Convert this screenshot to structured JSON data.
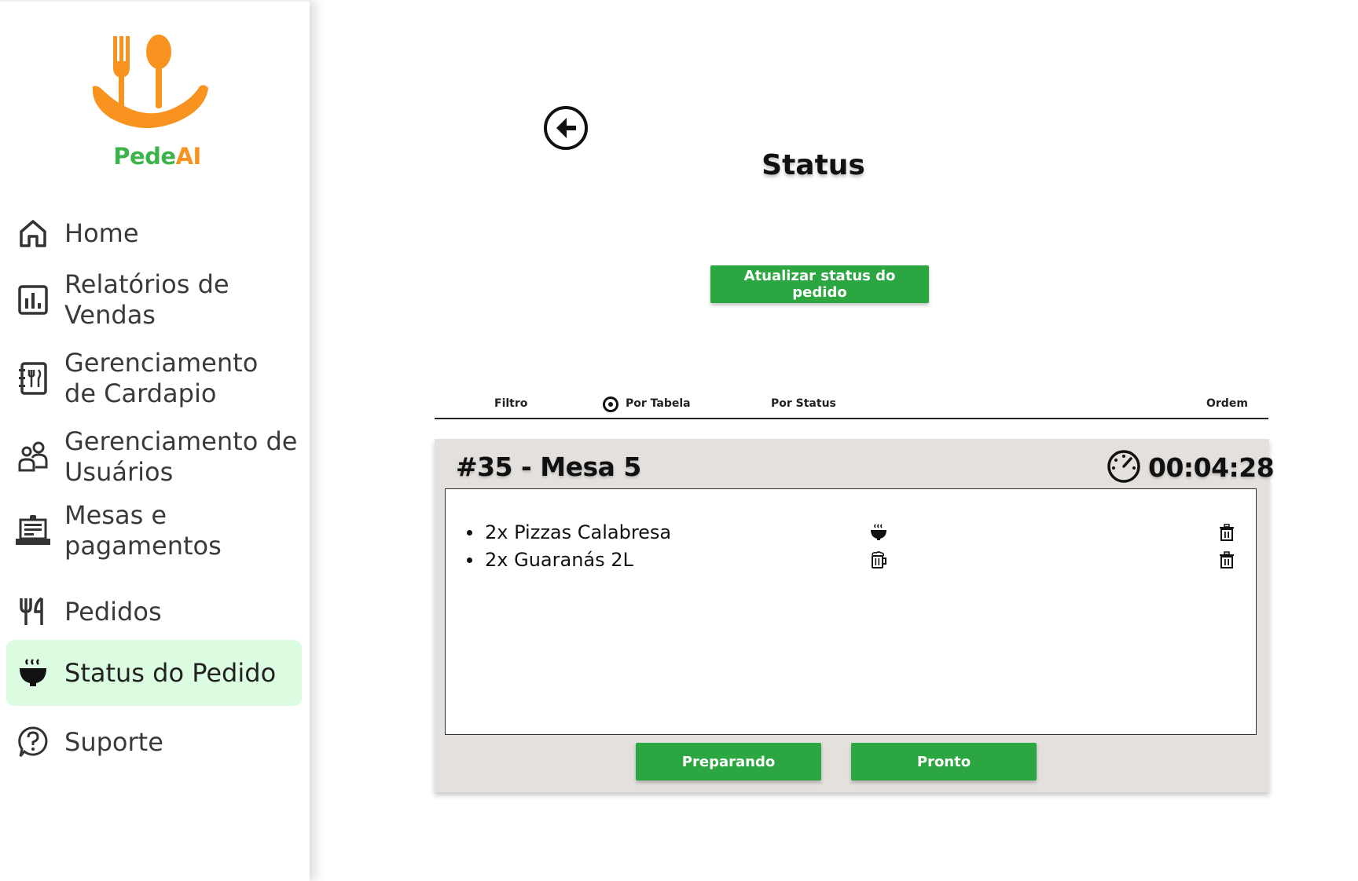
{
  "brand": {
    "name_part1": "Pede",
    "name_part2": "AI",
    "color_green": "#3cb44b",
    "color_orange": "#f7931e"
  },
  "sidebar": {
    "items": [
      {
        "label": "Home",
        "icon": "home-icon"
      },
      {
        "label": "Relatórios de Vendas",
        "icon": "report-icon"
      },
      {
        "label": "Gerenciamento de Cardapio",
        "icon": "menu-book-icon"
      },
      {
        "label": "Gerenciamento de Usuários",
        "icon": "users-icon"
      },
      {
        "label": "Mesas e pagamentos",
        "icon": "cash-register-icon"
      },
      {
        "label": "Pedidos",
        "icon": "utensils-icon"
      },
      {
        "label": "Status do Pedido",
        "icon": "hot-bowl-icon",
        "active": true
      },
      {
        "label": "Suporte",
        "icon": "help-icon"
      }
    ],
    "active_bg": "#dcfce1"
  },
  "page": {
    "title": "Status",
    "update_button": "Atualizar status do pedido"
  },
  "filter": {
    "label": "Filtro",
    "option_table": "Por Tabela",
    "option_status": "Por Status",
    "order_label": "Ordem",
    "selected": "Por Tabela"
  },
  "order": {
    "title": "#35 - Mesa 5",
    "timer": "00:04:28",
    "items": [
      {
        "text": "2x Pizzas Calabresa",
        "status_icon": "hot-bowl-icon"
      },
      {
        "text": "2x Guaranás 2L",
        "status_icon": "beer-mug-icon"
      }
    ],
    "buttons": {
      "preparing": "Preparando",
      "ready": "Pronto"
    }
  },
  "colors": {
    "accent_green": "#2ca640",
    "card_bg": "#e3e0dd"
  }
}
